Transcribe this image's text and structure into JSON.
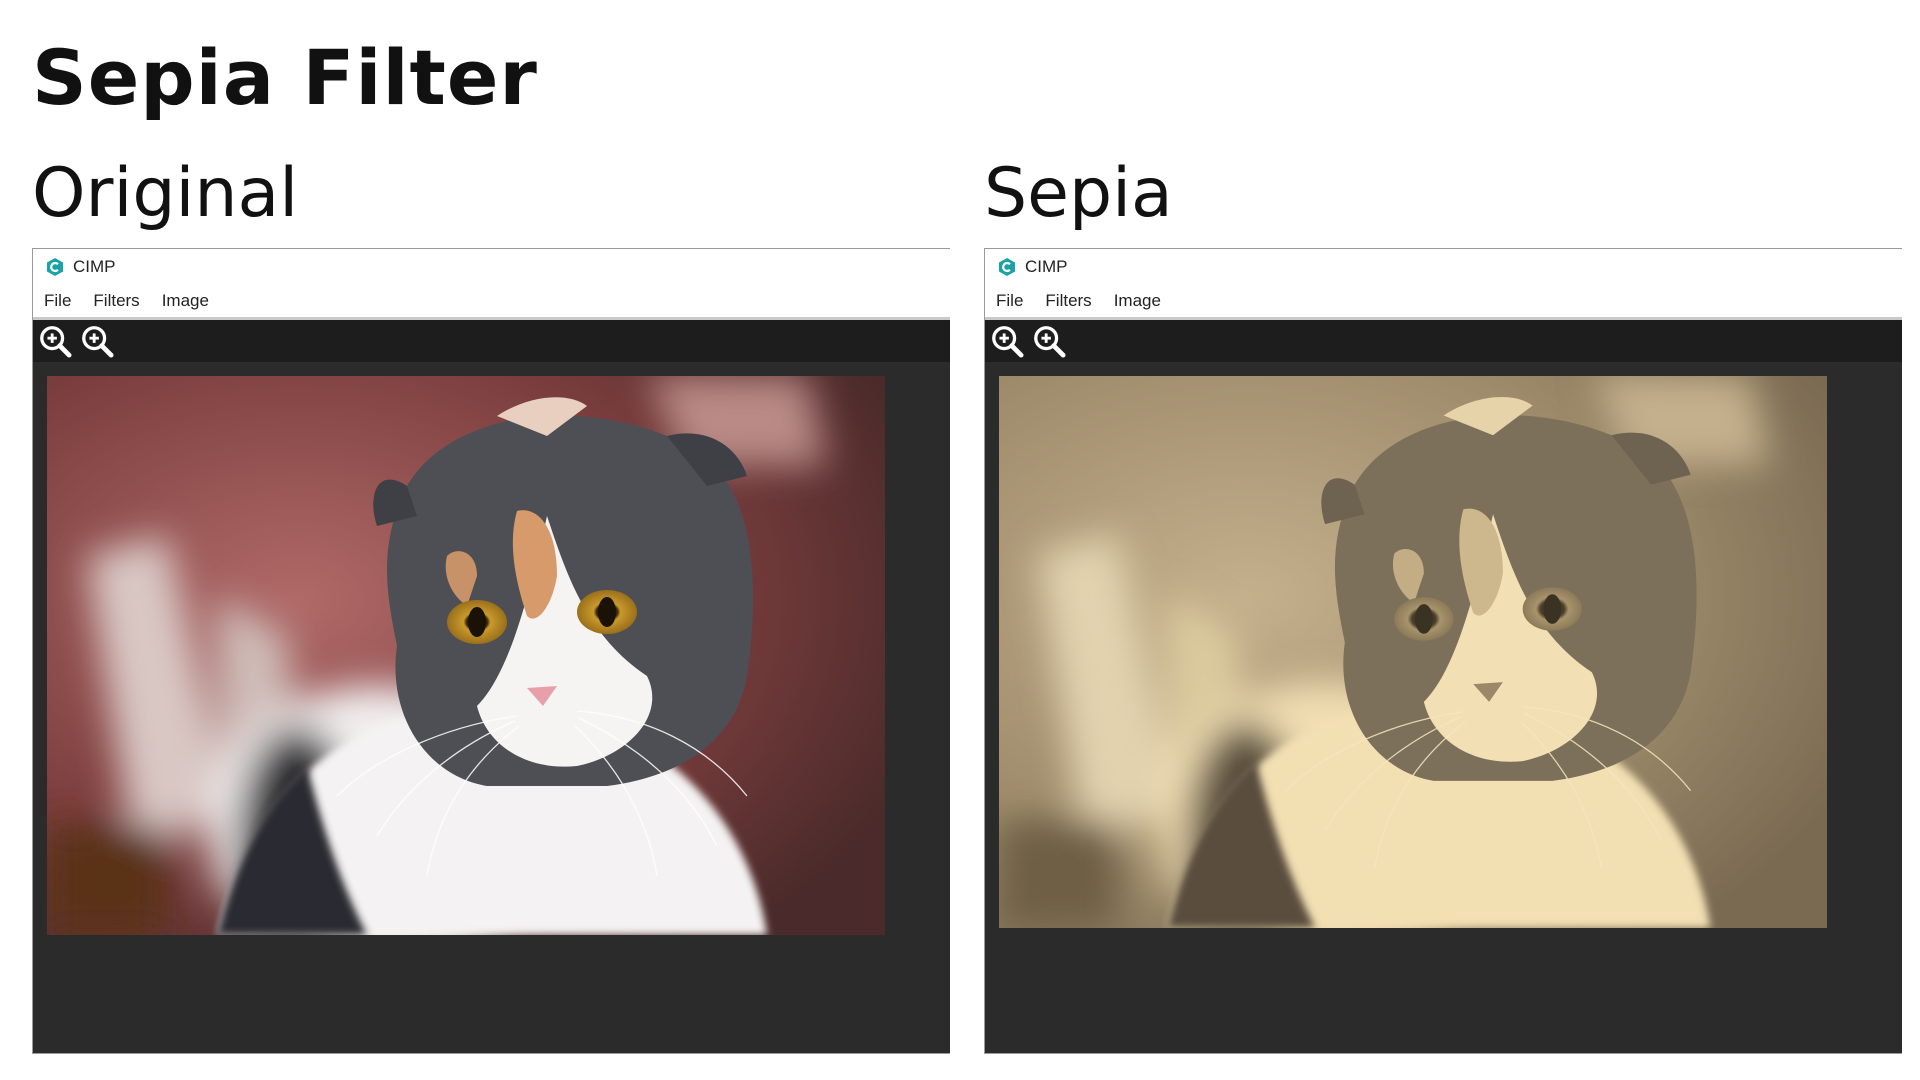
{
  "page_title": "Sepia Filter",
  "panels": [
    {
      "heading": "Original",
      "window": {
        "app_name": "CIMP",
        "menu": [
          "File",
          "Filters",
          "Image"
        ],
        "toolbar": [
          "zoom-in-icon",
          "zoom-out-icon"
        ]
      },
      "image": {
        "subject": "cat-photo",
        "tone": "color"
      }
    },
    {
      "heading": "Sepia",
      "window": {
        "app_name": "CIMP",
        "menu": [
          "File",
          "Filters",
          "Image"
        ],
        "toolbar": [
          "zoom-in-icon",
          "zoom-out-icon"
        ]
      },
      "image": {
        "subject": "cat-photo",
        "tone": "sepia"
      }
    }
  ],
  "colors": {
    "logo": "#1aa3a6",
    "toolbar_bg": "#1d1d1d",
    "canvas_bg": "#2b2b2b",
    "sepia_tint": "#e2cda1"
  }
}
